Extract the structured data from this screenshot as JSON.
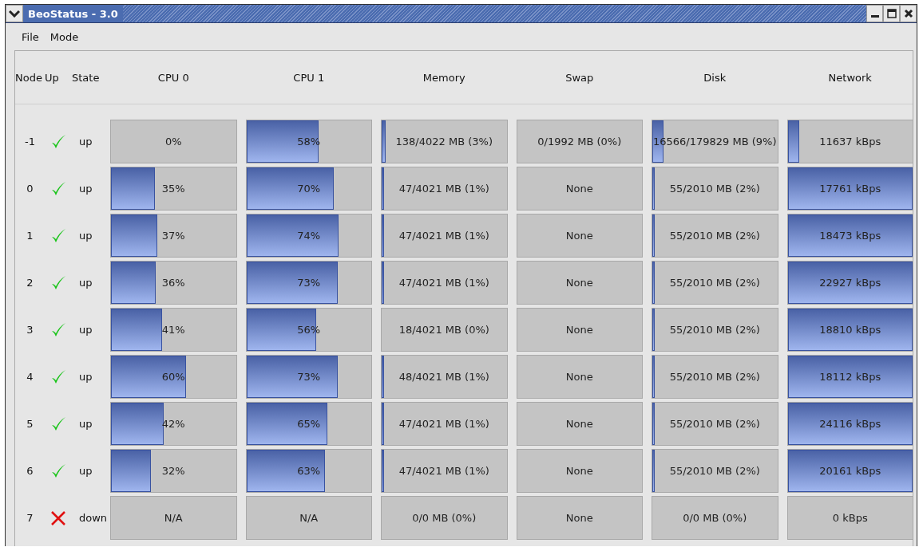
{
  "window": {
    "title": "BeoStatus - 3.0"
  },
  "menu": [
    "File",
    "Mode"
  ],
  "columns": [
    "Node",
    "Up",
    "State",
    "CPU 0",
    "CPU 1",
    "Memory",
    "Swap",
    "Disk",
    "Network"
  ],
  "rows": [
    {
      "node": "-1",
      "up": true,
      "state": "up",
      "cells": [
        {
          "text": "0%"
        },
        {
          "text": "58%",
          "level": 0.58
        },
        {
          "text": "138/4022 MB (3%)",
          "level": 0.03
        },
        {
          "text": "0/1992 MB (0%)"
        },
        {
          "text": "16566/179829 MB (9%)",
          "level": 0.09
        },
        {
          "text": "11637 kBps",
          "level": 0.09
        }
      ]
    },
    {
      "node": "0",
      "up": true,
      "state": "up",
      "cells": [
        {
          "text": "35%",
          "level": 0.35
        },
        {
          "text": "70%",
          "level": 0.7
        },
        {
          "text": "47/4021 MB (1%)",
          "level": 0.01
        },
        {
          "text": "None"
        },
        {
          "text": "55/2010 MB (2%)",
          "level": 0.02
        },
        {
          "text": "17761 kBps",
          "level": 1
        }
      ]
    },
    {
      "node": "1",
      "up": true,
      "state": "up",
      "cells": [
        {
          "text": "37%",
          "level": 0.37
        },
        {
          "text": "74%",
          "level": 0.74
        },
        {
          "text": "47/4021 MB (1%)",
          "level": 0.01
        },
        {
          "text": "None"
        },
        {
          "text": "55/2010 MB (2%)",
          "level": 0.02
        },
        {
          "text": "18473 kBps",
          "level": 1
        }
      ]
    },
    {
      "node": "2",
      "up": true,
      "state": "up",
      "cells": [
        {
          "text": "36%",
          "level": 0.36
        },
        {
          "text": "73%",
          "level": 0.73
        },
        {
          "text": "47/4021 MB (1%)",
          "level": 0.01
        },
        {
          "text": "None"
        },
        {
          "text": "55/2010 MB (2%)",
          "level": 0.02
        },
        {
          "text": "22927 kBps",
          "level": 1
        }
      ]
    },
    {
      "node": "3",
      "up": true,
      "state": "up",
      "cells": [
        {
          "text": "41%",
          "level": 0.41
        },
        {
          "text": "56%",
          "level": 0.56
        },
        {
          "text": "18/4021 MB (0%)"
        },
        {
          "text": "None"
        },
        {
          "text": "55/2010 MB (2%)",
          "level": 0.02
        },
        {
          "text": "18810 kBps",
          "level": 1
        }
      ]
    },
    {
      "node": "4",
      "up": true,
      "state": "up",
      "cells": [
        {
          "text": "60%",
          "level": 0.6
        },
        {
          "text": "73%",
          "level": 0.73
        },
        {
          "text": "48/4021 MB (1%)",
          "level": 0.01
        },
        {
          "text": "None"
        },
        {
          "text": "55/2010 MB (2%)",
          "level": 0.02
        },
        {
          "text": "18112 kBps",
          "level": 1
        }
      ]
    },
    {
      "node": "5",
      "up": true,
      "state": "up",
      "cells": [
        {
          "text": "42%",
          "level": 0.42
        },
        {
          "text": "65%",
          "level": 0.65
        },
        {
          "text": "47/4021 MB (1%)",
          "level": 0.01
        },
        {
          "text": "None"
        },
        {
          "text": "55/2010 MB (2%)",
          "level": 0.02
        },
        {
          "text": "24116 kBps",
          "level": 1
        }
      ]
    },
    {
      "node": "6",
      "up": true,
      "state": "up",
      "cells": [
        {
          "text": "32%",
          "level": 0.32
        },
        {
          "text": "63%",
          "level": 0.63
        },
        {
          "text": "47/4021 MB (1%)",
          "level": 0.01
        },
        {
          "text": "None"
        },
        {
          "text": "55/2010 MB (2%)",
          "level": 0.02
        },
        {
          "text": "20161 kBps",
          "level": 1
        }
      ]
    },
    {
      "node": "7",
      "up": false,
      "state": "down",
      "cells": [
        {
          "text": "N/A"
        },
        {
          "text": "N/A"
        },
        {
          "text": "0/0 MB (0%)"
        },
        {
          "text": "None"
        },
        {
          "text": "0/0 MB (0%)"
        },
        {
          "text": "0 kBps"
        }
      ]
    }
  ]
}
